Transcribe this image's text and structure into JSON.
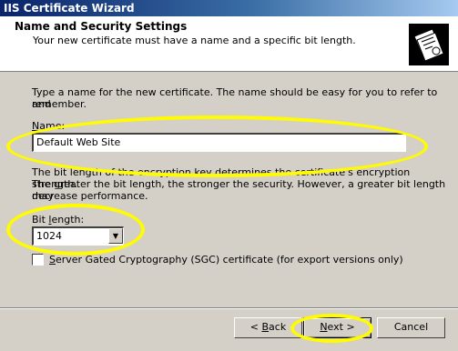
{
  "window": {
    "title": "IIS Certificate Wizard"
  },
  "header": {
    "title": "Name and Security Settings",
    "subtitle": "Your new certificate must have a name and a specific bit length.",
    "icon": "certificate-icon"
  },
  "main": {
    "intro_line1": "Type a name for the new certificate. The name should be easy for you to refer to and",
    "intro_line2": "remember.",
    "name_label_key": "N",
    "name_label_rest": "ame:",
    "name_value": "Default Web Site",
    "bits_text_line1": "The bit length of the encryption key determines the certificate's encryption strength.",
    "bits_text_line2": "The greater the bit length, the stronger the security.  However, a greater bit length may",
    "bits_text_line3": "decrease performance.",
    "bit_label_pre": "Bit ",
    "bit_label_key": "l",
    "bit_label_post": "ength:",
    "bit_length_value": "1024",
    "sgc_key": "S",
    "sgc_label": "erver Gated Cryptography (SGC) certificate (for export versions only)",
    "sgc_checked": false
  },
  "footer": {
    "back_prefix": "< ",
    "back_key": "B",
    "back_rest": "ack",
    "next_key": "N",
    "next_rest": "ext >",
    "cancel_label": "Cancel"
  },
  "colors": {
    "title_bar": "#0a246a",
    "dialog_bg": "#d4d0c8",
    "highlight": "#fffb00"
  }
}
